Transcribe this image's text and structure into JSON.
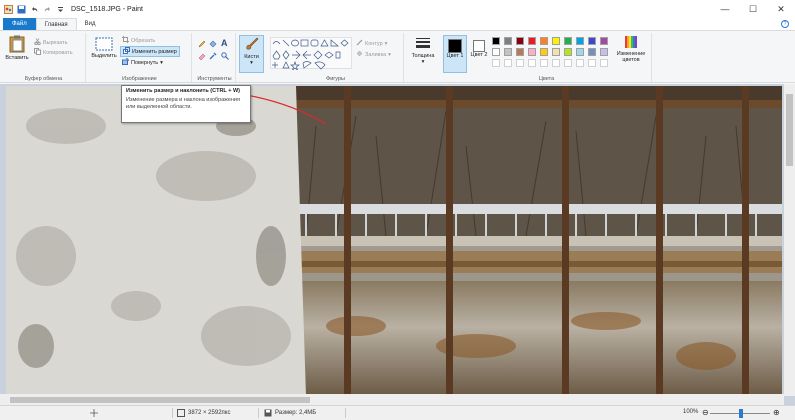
{
  "titlebar": {
    "title": "DSC_1518.JPG - Paint"
  },
  "window_controls": {
    "minimize": "—",
    "maximize": "☐",
    "close": "✕"
  },
  "tabs": [
    {
      "label": "Файл"
    },
    {
      "label": "Главная"
    },
    {
      "label": "Вид"
    }
  ],
  "ribbon": {
    "clipboard": {
      "paste": "Вставить",
      "cut": "Вырезать",
      "copy": "Копировать",
      "label": "Буфер обмена"
    },
    "image": {
      "select": "Выделить",
      "crop": "Обрезать",
      "resize": "Изменить размер",
      "rotate": "Повернуть",
      "label": "Изображение"
    },
    "tools": {
      "label": "Инструменты"
    },
    "brushes": {
      "label": "Кисти"
    },
    "shapes": {
      "outline": "Контур",
      "fill": "Заливка",
      "label": "Фигуры"
    },
    "size": {
      "label": "Толщина"
    },
    "colors": {
      "color1": "Цвет 1",
      "color2": "Цвет 2",
      "edit": "Изменение цветов",
      "label": "Цвета",
      "palette": [
        "#000000",
        "#7f7f7f",
        "#880015",
        "#ed1c24",
        "#ff7f27",
        "#fff200",
        "#22b14c",
        "#00a2e8",
        "#3f48cc",
        "#a349a4",
        "#ffffff",
        "#c3c3c3",
        "#b97a57",
        "#ffaec9",
        "#ffc90e",
        "#efe4b0",
        "#b5e61d",
        "#99d9ea",
        "#7092be",
        "#c8bfe7"
      ]
    }
  },
  "tooltip": {
    "title": "Изменить размер и наклонить (CTRL + W)",
    "description": "Изменение размера и наклона изображения или выделенной области."
  },
  "status": {
    "dimensions": "3872 × 2592пкс",
    "size": "Размер: 2,4МБ",
    "zoom": "100%"
  },
  "colors": {
    "accent": "#1979ca",
    "canvas_bg": "#c8d1dc"
  }
}
